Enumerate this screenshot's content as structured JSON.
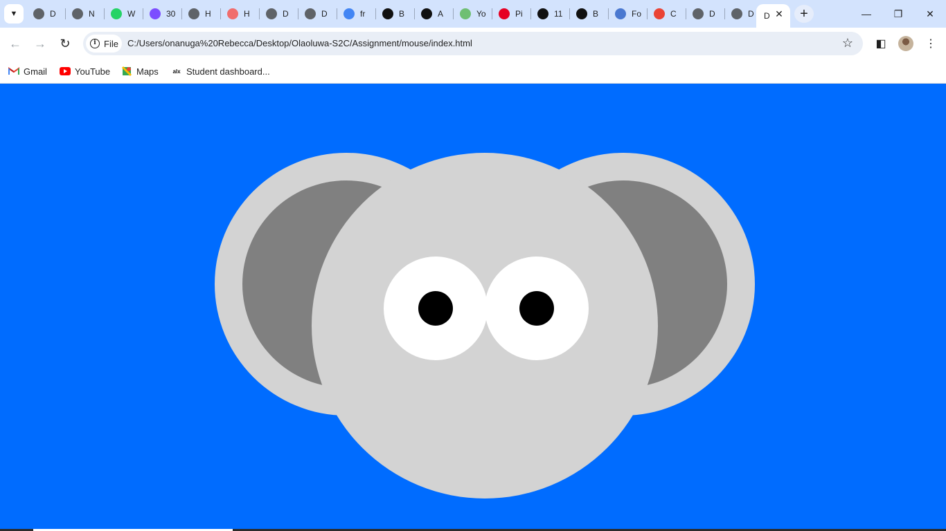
{
  "browser": {
    "tabs": [
      {
        "title": "D",
        "icon": "globe-icon",
        "color": "#5f6368"
      },
      {
        "title": "N",
        "icon": "chrome-icon",
        "color": "#5f6368"
      },
      {
        "title": "W",
        "icon": "whatsapp-icon",
        "color": "#25d366"
      },
      {
        "title": "30",
        "icon": "app-icon",
        "color": "#7c4dff"
      },
      {
        "title": "H",
        "icon": "globe-icon",
        "color": "#5f6368"
      },
      {
        "title": "H",
        "icon": "record-icon",
        "color": "#f06d6d"
      },
      {
        "title": "D",
        "icon": "globe-icon",
        "color": "#5f6368"
      },
      {
        "title": "D",
        "icon": "globe-icon",
        "color": "#5f6368"
      },
      {
        "title": "fr",
        "icon": "google-icon",
        "color": "#4285f4"
      },
      {
        "title": "B",
        "icon": "building-icon",
        "color": "#111111"
      },
      {
        "title": "A",
        "icon": "is-icon",
        "color": "#111111"
      },
      {
        "title": "Yo",
        "icon": "loop-icon",
        "color": "#6fbf73"
      },
      {
        "title": "Pi",
        "icon": "pinterest-icon",
        "color": "#e60023"
      },
      {
        "title": "11",
        "icon": "is-icon",
        "color": "#111111"
      },
      {
        "title": "B",
        "icon": "st-icon",
        "color": "#111111"
      },
      {
        "title": "Fo",
        "icon": "flag-icon",
        "color": "#4a78d0"
      },
      {
        "title": "C",
        "icon": "pinwheel-icon",
        "color": "#ea4335"
      },
      {
        "title": "D",
        "icon": "globe-icon",
        "color": "#5f6368"
      },
      {
        "title": "D",
        "icon": "globe-icon",
        "color": "#5f6368"
      }
    ],
    "active_tab": {
      "title": "D"
    },
    "address": {
      "chip_label": "File",
      "url": "C:/Users/onanuga%20Rebecca/Desktop/Olaoluwa-S2C/Assignment/mouse/index.html"
    },
    "bookmarks": [
      {
        "label": "Gmail",
        "icon": "gmail-icon"
      },
      {
        "label": "YouTube",
        "icon": "youtube-icon"
      },
      {
        "label": "Maps",
        "icon": "maps-icon"
      },
      {
        "label": "Student dashboard...",
        "icon": "alx-icon"
      }
    ]
  },
  "page": {
    "background_color": "#006cff",
    "mouse": {
      "ear_color": "#d3d3d3",
      "inner_ear_color": "#808080",
      "head_color": "#d3d3d3",
      "eye_color": "#ffffff",
      "pupil_color": "#000000"
    }
  }
}
